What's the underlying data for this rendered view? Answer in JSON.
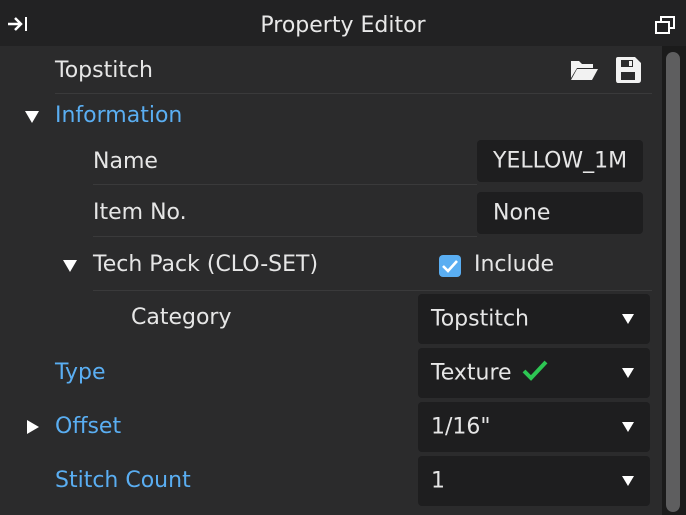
{
  "window": {
    "title": "Property Editor"
  },
  "header": {
    "name": "Topstitch"
  },
  "information": {
    "label": "Information",
    "name_label": "Name",
    "name_value": "YELLOW_1M",
    "item_no_label": "Item No.",
    "item_no_value": "None",
    "tech_pack_label": "Tech Pack (CLO-SET)",
    "include_label": "Include",
    "include_checked": true,
    "category_label": "Category",
    "category_value": "Topstitch"
  },
  "type": {
    "label": "Type",
    "value": "Texture",
    "status": "valid"
  },
  "offset": {
    "label": "Offset",
    "value": "1/16\""
  },
  "stitch_count": {
    "label": "Stitch Count",
    "value": "1"
  },
  "colors": {
    "accent": "#5aaef2",
    "check_green": "#2dc653",
    "background": "#2b2b2c",
    "field": "#1e1e1f"
  },
  "icons": [
    "pin-arrow-icon",
    "float-window-icon",
    "folder-open-icon",
    "save-icon",
    "expand-down-icon",
    "collapse-right-icon",
    "checkmark-icon",
    "dropdown-caret-icon"
  ]
}
